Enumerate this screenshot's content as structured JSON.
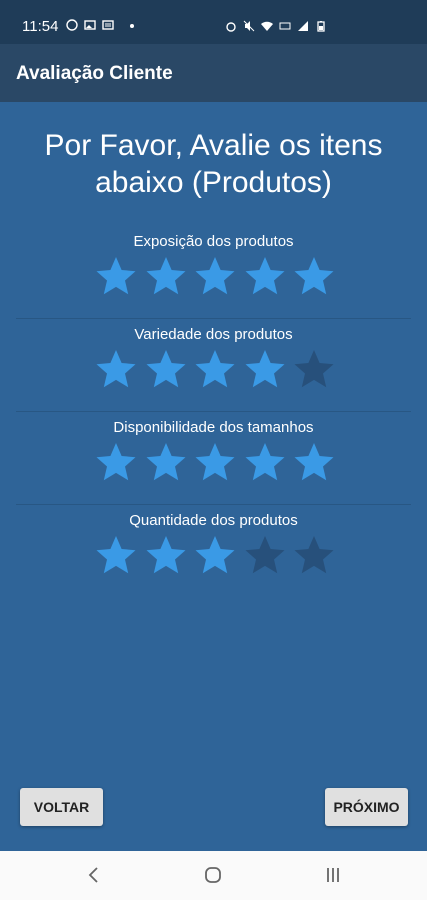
{
  "status": {
    "time": "11:54",
    "left_icons": [
      "whatsapp-icon",
      "gallery-icon",
      "message-icon"
    ],
    "right_icons": [
      "alarm-icon",
      "mute-icon",
      "wifi-icon",
      "volte-icon",
      "signal-icon",
      "battery-icon"
    ]
  },
  "app_bar": {
    "title": "Avaliação Cliente"
  },
  "heading": {
    "line1": "Por Favor, Avalie os itens",
    "line2": "abaixo (Produtos)"
  },
  "ratings": [
    {
      "label": "Exposição dos produtos",
      "value": 5,
      "max": 5
    },
    {
      "label": "Variedade dos produtos",
      "value": 4,
      "max": 5
    },
    {
      "label": "Disponibilidade dos tamanhos",
      "value": 5,
      "max": 5
    },
    {
      "label": "Quantidade dos produtos",
      "value": 3,
      "max": 5
    }
  ],
  "colors": {
    "star_filled": "#3a9ae6",
    "star_empty": "#27507b",
    "background": "#2f6498",
    "app_bar": "#2a4866"
  },
  "buttons": {
    "back_label": "VOLTAR",
    "next_label": "PRÓXIMO"
  },
  "nav": {
    "icons": [
      "back-icon",
      "home-icon",
      "recent-apps-icon"
    ]
  }
}
